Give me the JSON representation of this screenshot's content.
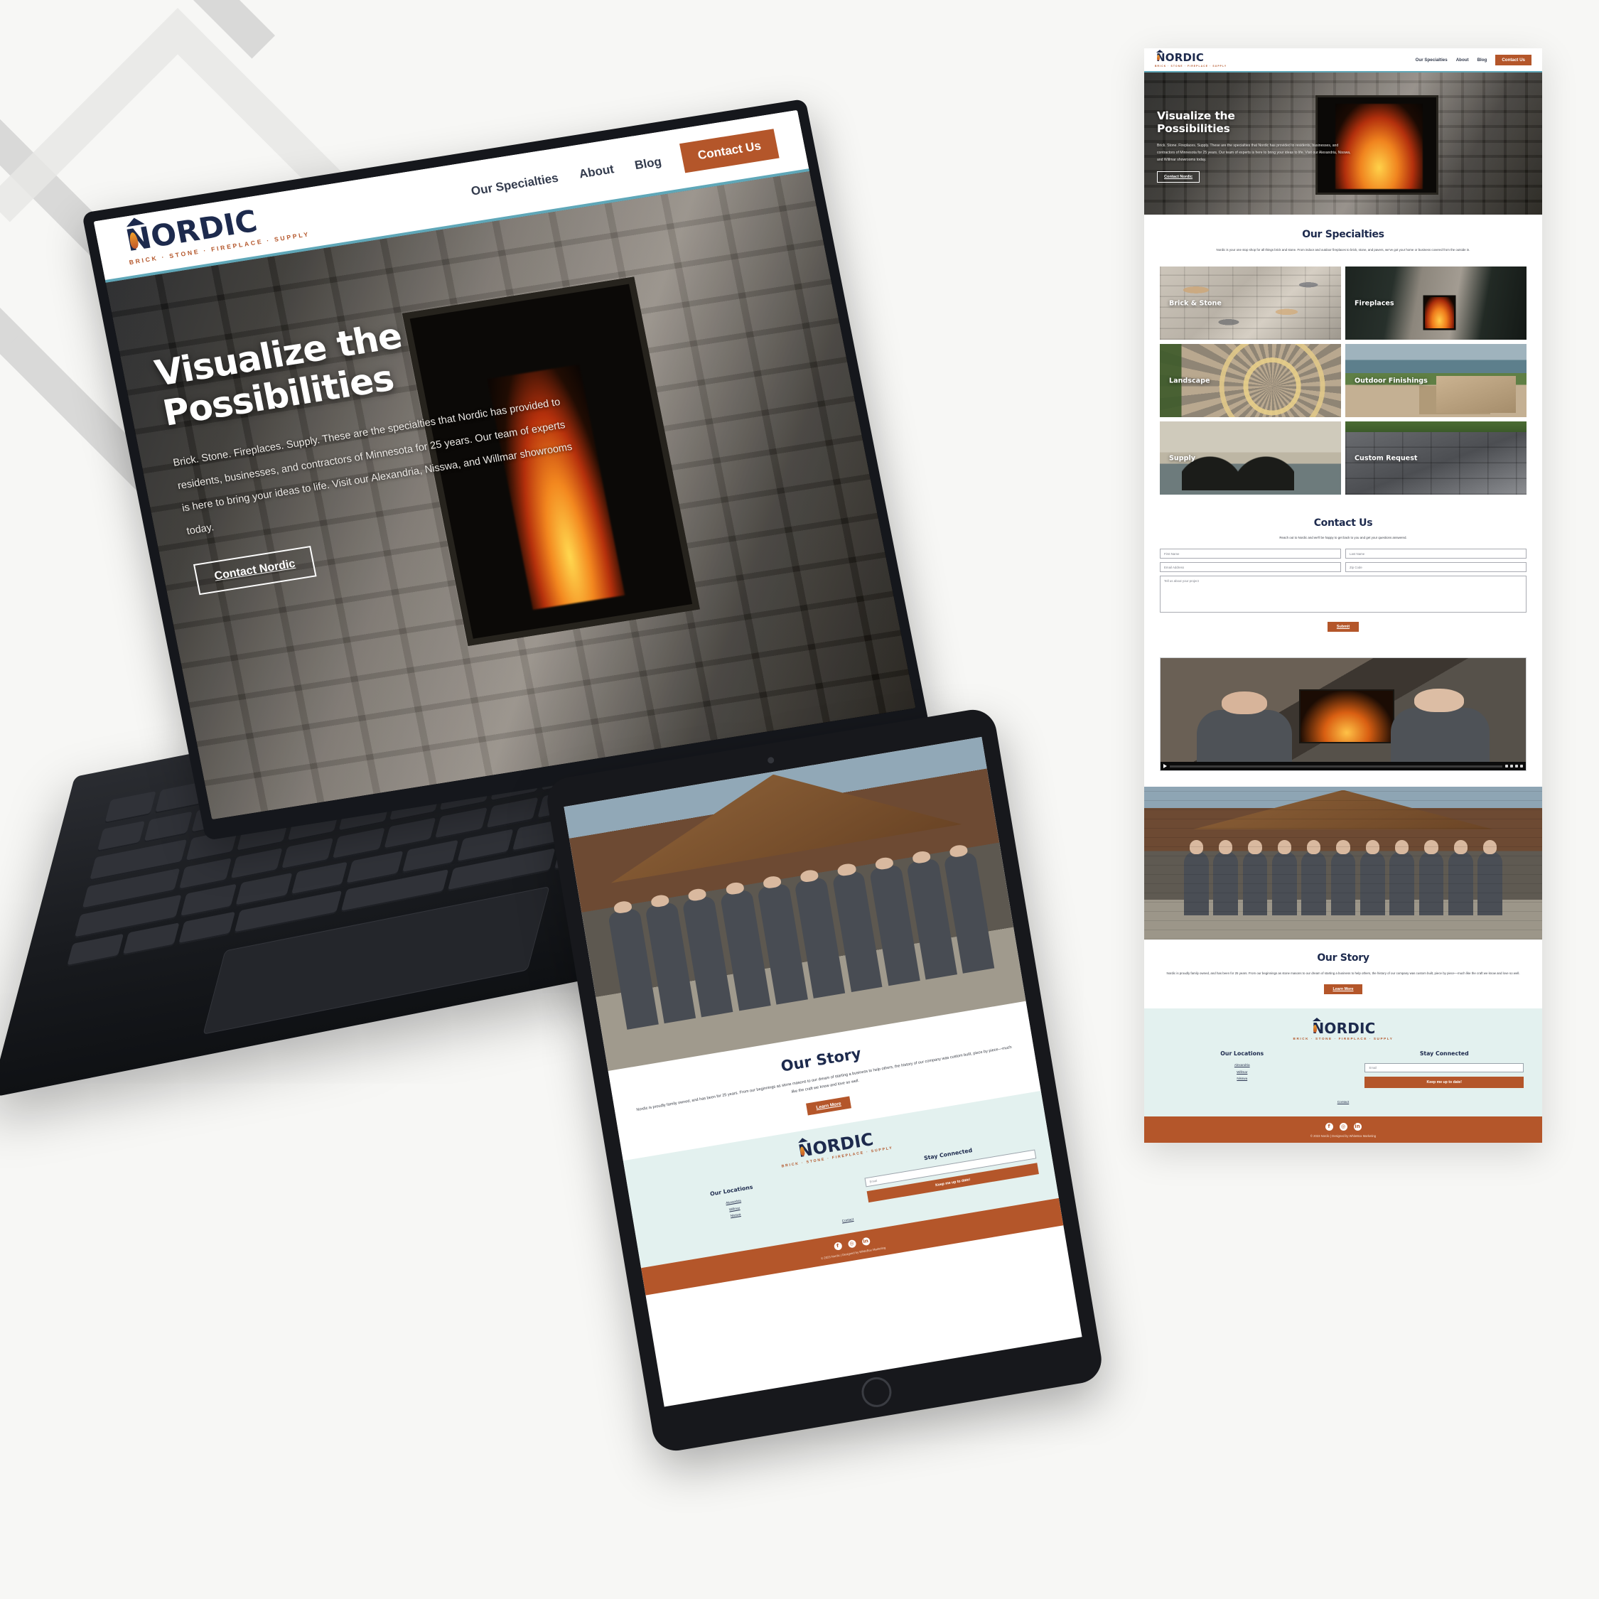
{
  "brand": {
    "name": "NORDIC",
    "tagline": "BRICK · STONE · FIREPLACE · SUPPLY",
    "colors": {
      "navy": "#1d2a4d",
      "rust": "#b4562a",
      "teal": "#5fa7b8",
      "mint": "#e3f1ef",
      "page_bg": "#f7f7f5"
    }
  },
  "nav": {
    "items": [
      {
        "label": "Our Specialties"
      },
      {
        "label": "About"
      },
      {
        "label": "Blog"
      }
    ],
    "cta": "Contact Us"
  },
  "hero": {
    "heading_line1": "Visualize the",
    "heading_line2": "Possibilities",
    "body": "Brick. Stone. Fireplaces. Supply. These are the specialties that Nordic has provided to residents, businesses, and contractors of Minnesota for 25 years. Our team of experts is here to bring your ideas to life. Visit our Alexandria, Nisswa, and Willmar showrooms today.",
    "cta": "Contact Nordic"
  },
  "specialties": {
    "title": "Our Specialties",
    "subtitle": "Nordic is your one stop shop for all things brick and stone. From indoor and outdoor fireplaces to brick, stone, and pavers, we've got your home or business covered from the outside in.",
    "cards": [
      {
        "label": "Brick & Stone",
        "image": "brick-stone-wall-photo"
      },
      {
        "label": "Fireplaces",
        "image": "indoor-stone-fireplace-photo"
      },
      {
        "label": "Landscape",
        "image": "paver-patio-photo"
      },
      {
        "label": "Outdoor Finishings",
        "image": "lakeside-outdoor-kitchen-photo"
      },
      {
        "label": "Supply",
        "image": "culvert-pipes-photo"
      },
      {
        "label": "Custom Request",
        "image": "block-retaining-wall-photo"
      }
    ]
  },
  "contact": {
    "title": "Contact Us",
    "subtitle": "Reach out to Nordic and we'll be happy to get back to you and get your questions answered.",
    "fields": [
      {
        "name": "first-name",
        "placeholder": "First Name",
        "value": ""
      },
      {
        "name": "last-name",
        "placeholder": "Last Name",
        "value": ""
      },
      {
        "name": "email-address",
        "placeholder": "Email Address",
        "value": ""
      },
      {
        "name": "zip-code",
        "placeholder": "Zip Code",
        "value": ""
      }
    ],
    "message_placeholder": "Tell us about your project",
    "submit": "Submit"
  },
  "video": {
    "caption_badge": "CC",
    "description": "two-nordic-team-members-interview-by-fireplace"
  },
  "team_photo": {
    "description": "nordic-staff-group-photo-outside-showroom"
  },
  "story": {
    "title": "Our Story",
    "body": "Nordic is proudly family owned, and has been for 25 years. From our beginnings as stone masons to our dream of starting a business to help others, the history of our company was custom built, piece by piece—much like the craft we know and love so well.",
    "cta": "Learn More"
  },
  "footer": {
    "locations_heading": "Our Locations",
    "locations": [
      {
        "label": "Alexandria"
      },
      {
        "label": "Willmar"
      },
      {
        "label": "Nisswa"
      }
    ],
    "contact_link": "Contact",
    "connected_heading": "Stay Connected",
    "email_placeholder": "Email",
    "email_value": "",
    "subscribe": "Keep me up to date!",
    "socials": [
      {
        "name": "facebook",
        "glyph": "f"
      },
      {
        "name": "instagram",
        "glyph": "◎"
      },
      {
        "name": "linkedin",
        "glyph": "in"
      }
    ],
    "copyright": "© 2023 Nordic | Designed by WhiteBox Marketing"
  }
}
